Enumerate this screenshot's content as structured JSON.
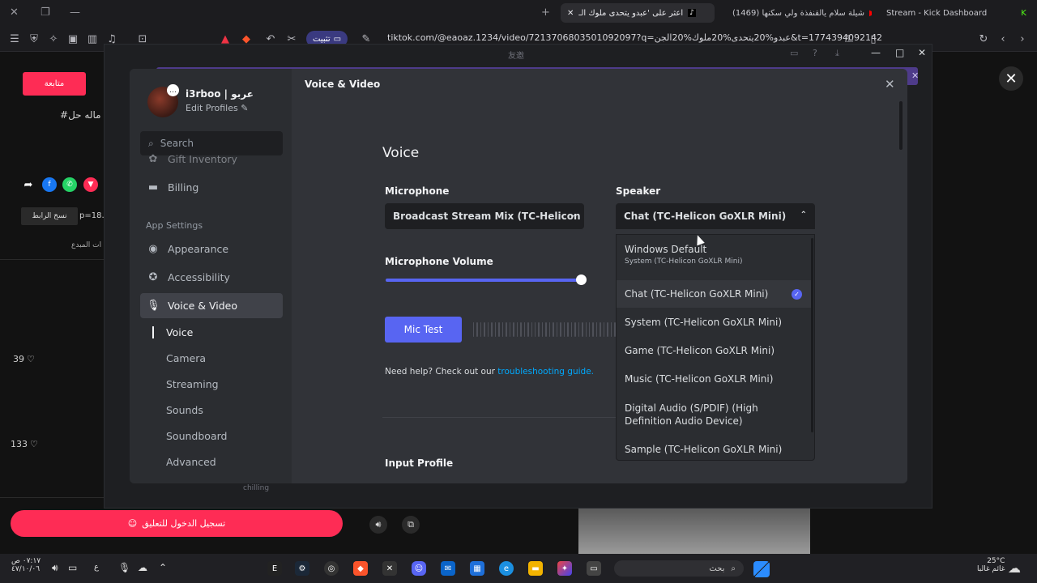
{
  "browser": {
    "tabs": [
      {
        "title": "Stream - Kick Dashboard"
      },
      {
        "title": "(1469) شيلة سلام يالقنفذة ولي سكنها"
      },
      {
        "title": "اعثر على 'عبدو يتحدى ملوك الـ"
      }
    ],
    "url": "tiktok.com/@eaoaz.1234/video/7213706803501092097?q=عبدو%20يتحدى%20ملوك%20الجن&t=1774394092142",
    "pin_label": "تثبيت"
  },
  "tiktok": {
    "follow_label": "متابعة",
    "hashtag_line": "#ي ماله حل",
    "copy_link": "نسخ الرابط",
    "link_snippet": "p=18...",
    "creator_label": "ات المبدع",
    "like_count_1": "39",
    "like_count_2": "133",
    "login_label": "تسجيل الدخول للتعليق",
    "footer_user": "chilling"
  },
  "discord": {
    "window_title": "友邀",
    "profile": {
      "name": "i3rboo | عربو",
      "edit_label": "Edit Profiles"
    },
    "search_placeholder": "Search",
    "nav": {
      "gift_inventory": "Gift Inventory",
      "billing": "Billing",
      "app_settings_header": "App Settings",
      "appearance": "Appearance",
      "accessibility": "Accessibility",
      "voice_video": "Voice & Video",
      "sub": [
        "Voice",
        "Camera",
        "Streaming",
        "Sounds",
        "Soundboard",
        "Advanced"
      ]
    },
    "breadcrumb": "Voice & Video",
    "section_title": "Voice",
    "microphone_label": "Microphone",
    "microphone_value": "Broadcast Stream Mix (TC-Helicon G",
    "speaker_label": "Speaker",
    "speaker_value": "Chat (TC-Helicon GoXLR Mini)",
    "mic_volume_label": "Microphone Volume",
    "mic_volume_level": 1.0,
    "mic_test_label": "Mic Test",
    "help_text": "Need help? Check out our ",
    "help_link": "troubleshooting guide.",
    "input_profile_label": "Input Profile",
    "speaker_options": [
      {
        "label": "Windows Default",
        "sub": "System (TC-Helicon GoXLR Mini)"
      },
      {
        "label": "Chat (TC-Helicon GoXLR Mini)",
        "selected": true
      },
      {
        "label": "System (TC-Helicon GoXLR Mini)"
      },
      {
        "label": "Game (TC-Helicon GoXLR Mini)"
      },
      {
        "label": "Music (TC-Helicon GoXLR Mini)"
      },
      {
        "label": "Digital Audio (S/PDIF) (High Definition Audio Device)"
      },
      {
        "label": "Sample (TC-Helicon GoXLR Mini)"
      }
    ],
    "accent_color": "#5865f2"
  },
  "taskbar": {
    "weather_temp": "25°C",
    "weather_desc": "غائم غالبا",
    "search_label": "بحث",
    "time": "٠٧:١٧ ص",
    "date": "٤٧/١٠/٠٦",
    "lang": "ع"
  }
}
